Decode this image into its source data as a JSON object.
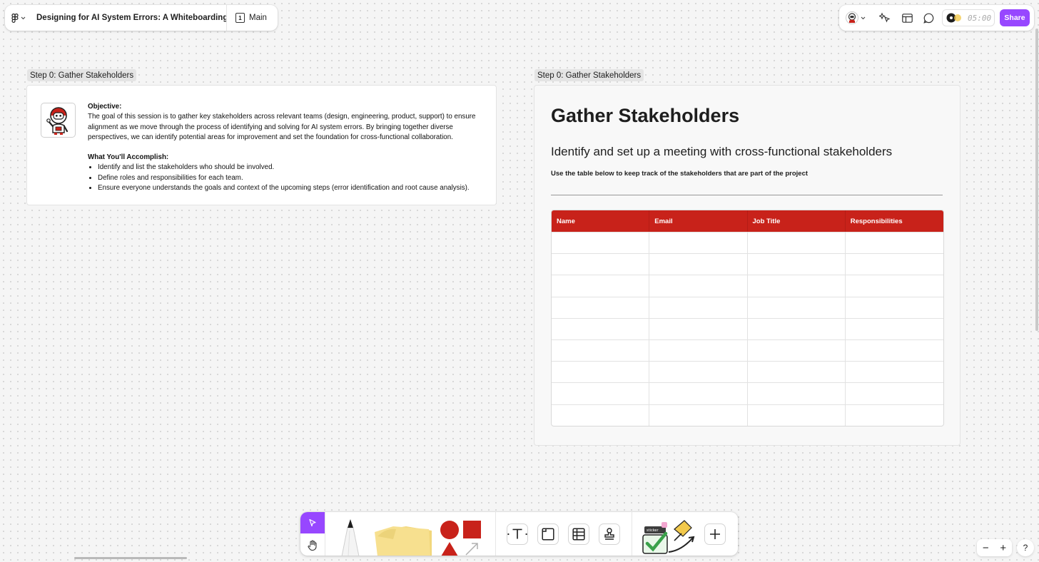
{
  "header": {
    "file_title": "Designing for AI System Errors: A Whiteboarding Wo...",
    "page_number": "1",
    "page_name": "Main"
  },
  "toolbar_right": {
    "timer": "05:00",
    "share_label": "Share",
    "accent_color": "#9747ff"
  },
  "left_section": {
    "label": "Step 0: Gather Stakeholders",
    "objective_heading": "Objective:",
    "objective_text": "The goal of this session is to gather key stakeholders across relevant teams (design, engineering, product, support) to ensure alignment as we move through the process of identifying and solving for AI system errors. By bringing together diverse perspectives, we can identify potential areas for improvement and set the foundation for cross-functional collaboration.",
    "accomplish_heading": "What You'll Accomplish:",
    "bullets": [
      "Identify and list the stakeholders who should be involved.",
      "Define roles and responsibilities for each team.",
      "Ensure everyone understands the goals and context of the upcoming steps (error identification and root cause analysis)."
    ]
  },
  "right_section": {
    "label": "Step 0: Gather Stakeholders",
    "title": "Gather Stakeholders",
    "subtitle": "Identify and set up a meeting with cross-functional stakeholders",
    "instruction": "Use the table below to keep track of the stakeholders that are part of the project",
    "table": {
      "header_color": "#c8221a",
      "columns": [
        "Name",
        "Email",
        "Job Title",
        "Responsibilities"
      ],
      "empty_rows": 9
    }
  },
  "bottom_toolbar": {
    "tools": [
      "select",
      "hand",
      "pen",
      "sticky-note",
      "shapes",
      "text",
      "section",
      "table",
      "stamp",
      "stickers",
      "add"
    ]
  },
  "zoom": {
    "minus": "−",
    "plus": "+",
    "help": "?"
  }
}
